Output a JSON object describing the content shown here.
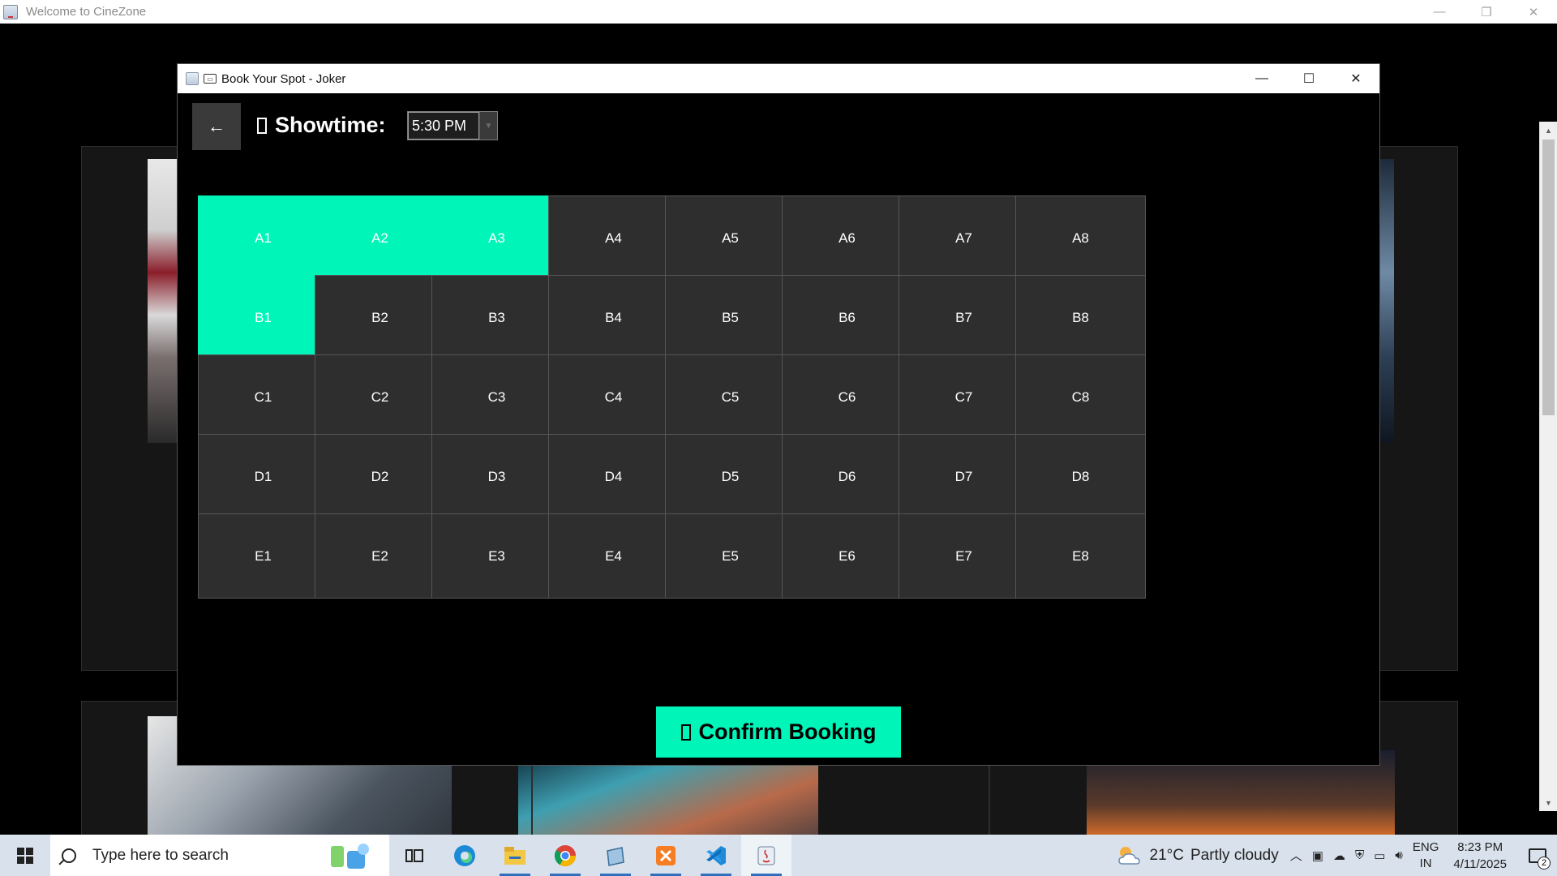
{
  "outer_window": {
    "title": "Welcome to CineZone",
    "controls": {
      "minimize": "—",
      "restore": "❐",
      "close": "✕"
    }
  },
  "dialog": {
    "title": "Book Your Spot - Joker",
    "controls": {
      "minimize": "—",
      "maximize": "☐",
      "close": "✕"
    },
    "back_label": "←",
    "showtime_label": "Showtime:",
    "showtime_value": "5:30 PM",
    "seats": [
      {
        "label": "A1",
        "selected": true
      },
      {
        "label": "A2",
        "selected": true
      },
      {
        "label": "A3",
        "selected": true
      },
      {
        "label": "A4",
        "selected": false
      },
      {
        "label": "A5",
        "selected": false
      },
      {
        "label": "A6",
        "selected": false
      },
      {
        "label": "A7",
        "selected": false
      },
      {
        "label": "A8",
        "selected": false
      },
      {
        "label": "B1",
        "selected": true
      },
      {
        "label": "B2",
        "selected": false
      },
      {
        "label": "B3",
        "selected": false
      },
      {
        "label": "B4",
        "selected": false
      },
      {
        "label": "B5",
        "selected": false
      },
      {
        "label": "B6",
        "selected": false
      },
      {
        "label": "B7",
        "selected": false
      },
      {
        "label": "B8",
        "selected": false
      },
      {
        "label": "C1",
        "selected": false
      },
      {
        "label": "C2",
        "selected": false
      },
      {
        "label": "C3",
        "selected": false
      },
      {
        "label": "C4",
        "selected": false
      },
      {
        "label": "C5",
        "selected": false
      },
      {
        "label": "C6",
        "selected": false
      },
      {
        "label": "C7",
        "selected": false
      },
      {
        "label": "C8",
        "selected": false
      },
      {
        "label": "D1",
        "selected": false
      },
      {
        "label": "D2",
        "selected": false
      },
      {
        "label": "D3",
        "selected": false
      },
      {
        "label": "D4",
        "selected": false
      },
      {
        "label": "D5",
        "selected": false
      },
      {
        "label": "D6",
        "selected": false
      },
      {
        "label": "D7",
        "selected": false
      },
      {
        "label": "D8",
        "selected": false
      },
      {
        "label": "E1",
        "selected": false
      },
      {
        "label": "E2",
        "selected": false
      },
      {
        "label": "E3",
        "selected": false
      },
      {
        "label": "E4",
        "selected": false
      },
      {
        "label": "E5",
        "selected": false
      },
      {
        "label": "E6",
        "selected": false
      },
      {
        "label": "E7",
        "selected": false
      },
      {
        "label": "E8",
        "selected": false
      }
    ],
    "confirm_label": "Confirm Booking"
  },
  "colors": {
    "selected_seat": "#00f5b9",
    "available_seat": "#2e2e2e",
    "confirm_button": "#00f5b9"
  },
  "taskbar": {
    "search_placeholder": "Type here to search",
    "weather_temp": "21°C",
    "weather_text": "Partly cloudy",
    "lang_top": "ENG",
    "lang_bottom": "IN",
    "time": "8:23 PM",
    "date": "4/11/2025",
    "notification_count": "2",
    "pinned_icons": [
      "task-view-icon",
      "edge-icon",
      "file-explorer-icon",
      "chrome-icon",
      "notepad-icon",
      "xampp-icon",
      "vscode-icon",
      "java-icon"
    ]
  }
}
